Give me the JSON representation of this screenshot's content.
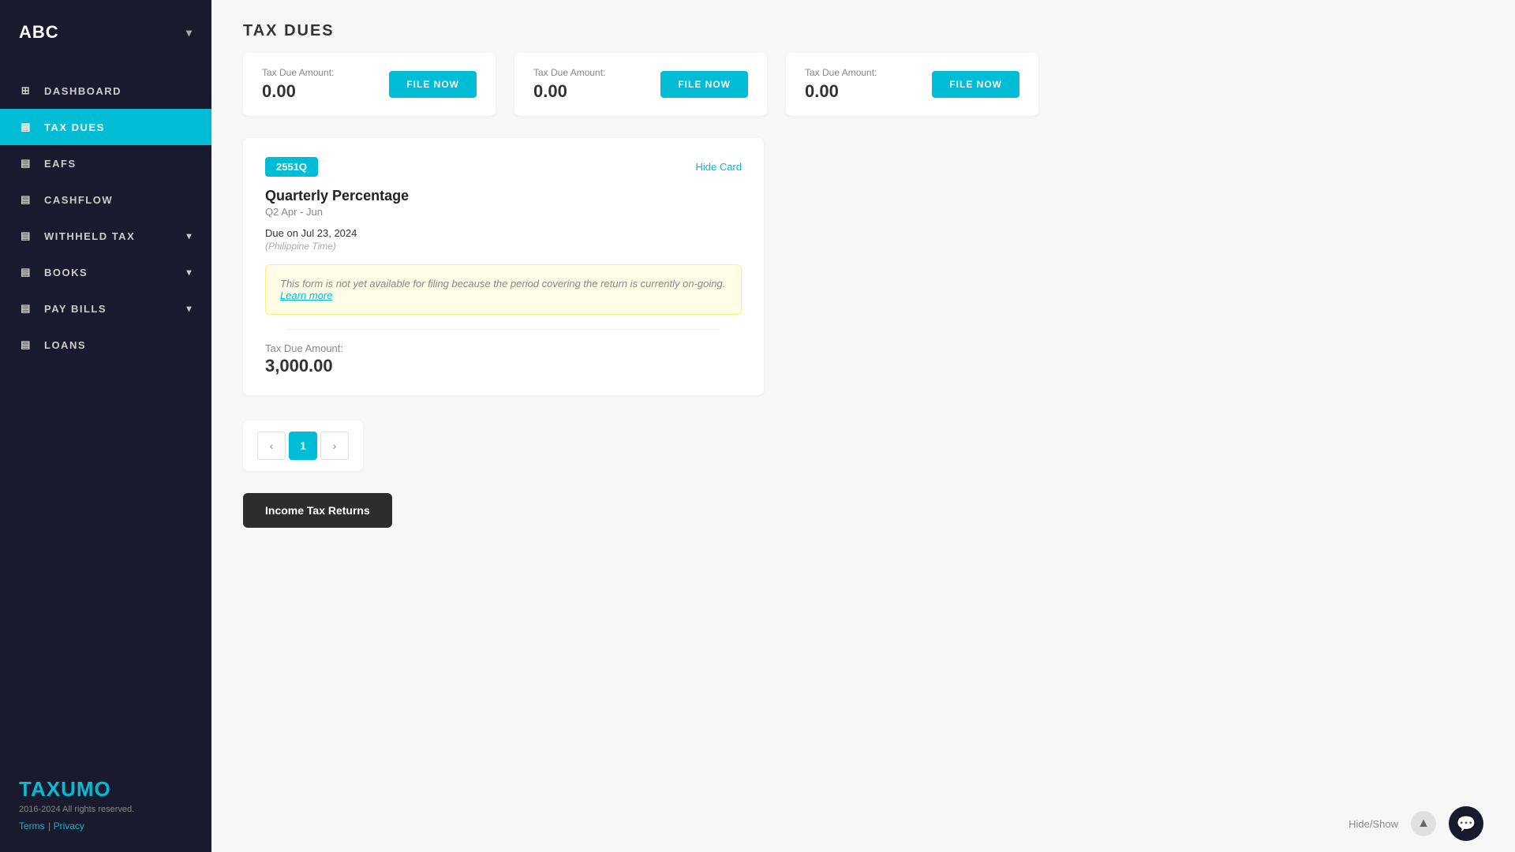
{
  "sidebar": {
    "company": "ABC",
    "chevron": "▾",
    "nav_items": [
      {
        "id": "dashboard",
        "label": "DASHBOARD",
        "icon": "⊞",
        "active": false
      },
      {
        "id": "tax-dues",
        "label": "TAX DUES",
        "icon": "📋",
        "active": true
      },
      {
        "id": "eafs",
        "label": "EAFS",
        "icon": "📁",
        "active": false
      },
      {
        "id": "cashflow",
        "label": "CASHFLOW",
        "icon": "💰",
        "active": false
      },
      {
        "id": "withheld-tax",
        "label": "WITHHELD TAX",
        "icon": "🔖",
        "active": false,
        "has_chevron": true
      },
      {
        "id": "books",
        "label": "BOOKS",
        "icon": "📚",
        "active": false,
        "has_chevron": true
      },
      {
        "id": "pay-bills",
        "label": "PAY BILLS",
        "icon": "💳",
        "active": false,
        "has_chevron": true
      },
      {
        "id": "loans",
        "label": "LOANS",
        "icon": "🏦",
        "active": false
      }
    ],
    "logo": {
      "prefix": "TAX",
      "suffix": "UMO"
    },
    "copyright": "2016-2024 All rights reserved.",
    "terms_label": "Terms",
    "privacy_label": "Privacy"
  },
  "main": {
    "page_title": "TAX DUES",
    "top_cards": [
      {
        "label": "Tax Due Amount:",
        "amount": "0.00"
      },
      {
        "label": "Tax Due Amount:",
        "amount": "0.00"
      },
      {
        "label": "Tax Due Amount:",
        "amount": "0.00"
      }
    ],
    "file_now_label": "FILE NOW",
    "form_card": {
      "badge": "2551Q",
      "hide_card_label": "Hide Card",
      "title": "Quarterly Percentage",
      "period": "Q2 Apr - Jun",
      "due_label": "Due on Jul 23, 2024",
      "due_tz": "(Philippine Time)",
      "warning": "This form is not yet available for filing because the period covering the return is currently on-going.",
      "learn_more": "Learn more",
      "tax_due_label": "Tax Due Amount:",
      "tax_due_amount": "3,000.00"
    },
    "pagination": {
      "prev": "‹",
      "pages": [
        "1"
      ],
      "next": "›",
      "active_page": "1"
    },
    "income_tax_btn": "Income Tax Returns",
    "hide_show_label": "Hide/Show",
    "scroll_top_icon": "▲",
    "chat_icon": "💬"
  }
}
